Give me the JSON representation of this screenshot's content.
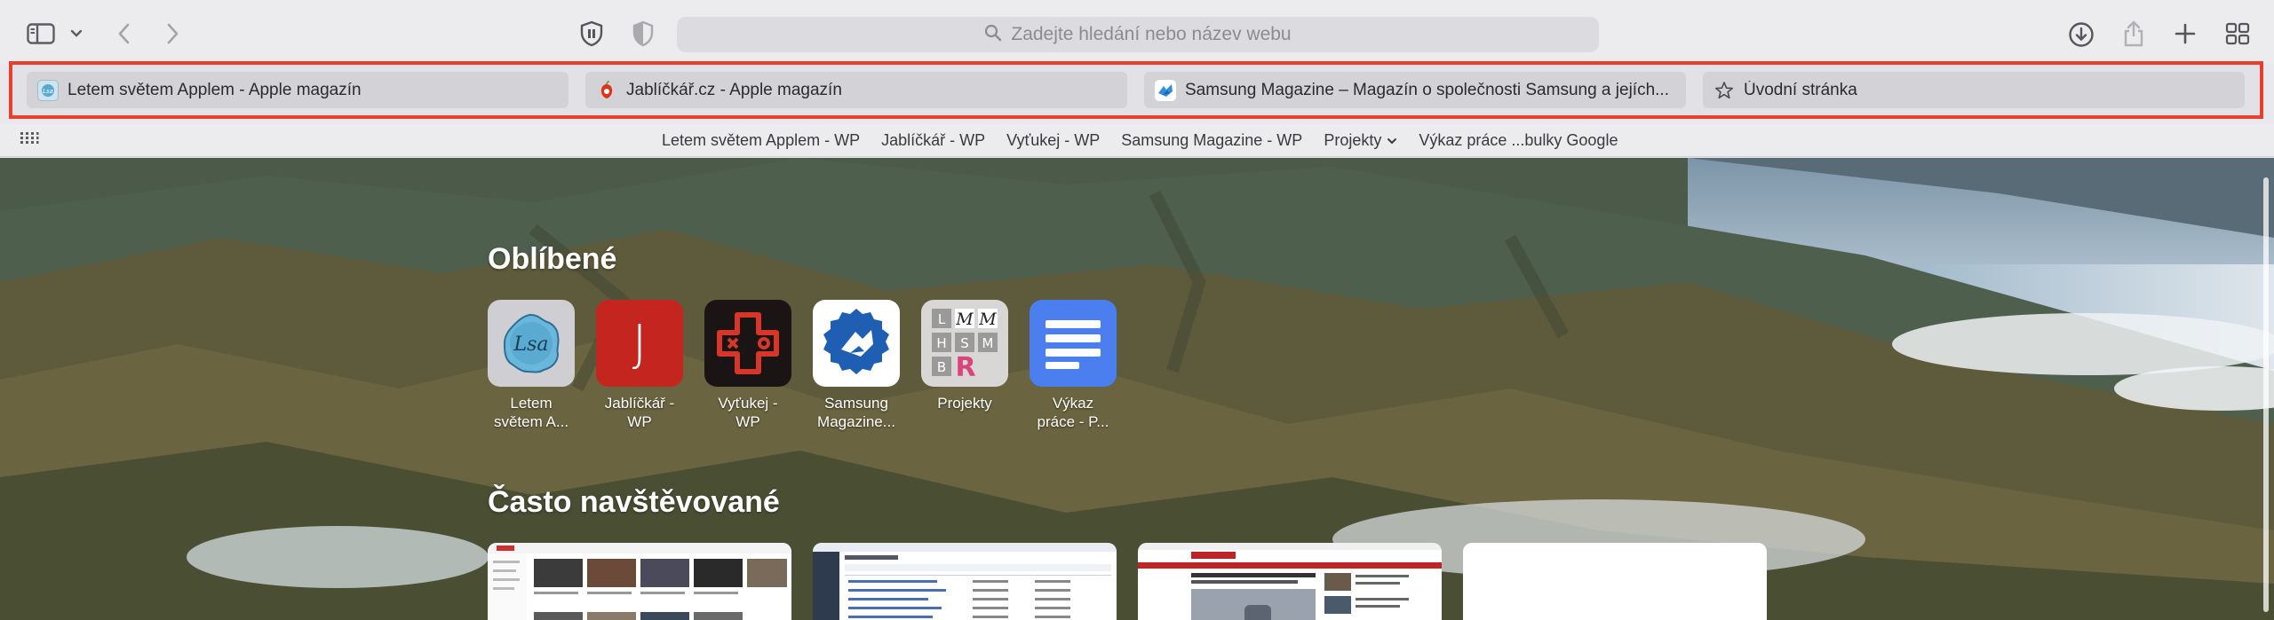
{
  "address_bar": {
    "placeholder": "Zadejte hledání nebo název webu"
  },
  "toolbar_icons": [
    "sidebar-icon",
    "chevron-down-icon",
    "back-icon",
    "forward-icon",
    "privacy-shield-icon",
    "shield-icon",
    "magnifier-icon",
    "download-icon",
    "share-icon",
    "plus-icon",
    "tab-overview-icon"
  ],
  "tabs": [
    {
      "title": "Letem světem Applem - Apple magazín",
      "icon": "lsa-favicon"
    },
    {
      "title": "Jablíčkář.cz - Apple magazín",
      "icon": "jablickar-favicon"
    },
    {
      "title": "Samsung Magazine – Magazín o společnosti Samsung a jejích...",
      "icon": "samsung-magazine-favicon"
    },
    {
      "title": "Úvodní stránka",
      "icon": "star-icon"
    }
  ],
  "bookmarks": [
    {
      "label": "Letem světem Applem - WP"
    },
    {
      "label": "Jablíčkář - WP"
    },
    {
      "label": "Vyťukej - WP"
    },
    {
      "label": "Samsung Magazine - WP"
    },
    {
      "label": "Projekty"
    },
    {
      "label": "Výkaz práce ...bulky Google"
    }
  ],
  "favorites": {
    "title": "Oblíbené",
    "items": [
      {
        "line1": "Letem",
        "line2": "světem A...",
        "icon_text": "Lsa"
      },
      {
        "line1": "Jablíčkář -",
        "line2": "WP",
        "icon_text": "J"
      },
      {
        "line1": "Vyťukej -",
        "line2": "WP",
        "icon_text": ""
      },
      {
        "line1": "Samsung",
        "line2": "Magazine...",
        "icon_text": ""
      },
      {
        "line1": "Projekty",
        "line2": "",
        "icon_text": ""
      },
      {
        "line1": "Výkaz",
        "line2": "práce - P...",
        "icon_text": ""
      }
    ]
  },
  "projekty_icon": {
    "cells": [
      "L",
      "M",
      "M",
      "H",
      "S",
      "M",
      "B",
      "R"
    ]
  },
  "frequent": {
    "title": "Často navštěvované"
  },
  "colors": {
    "accent_highlight": "#e9402d",
    "jablickar_red": "#c4261f",
    "samsung_blue": "#1e5fb3",
    "docs_blue": "#4b7ff0"
  }
}
